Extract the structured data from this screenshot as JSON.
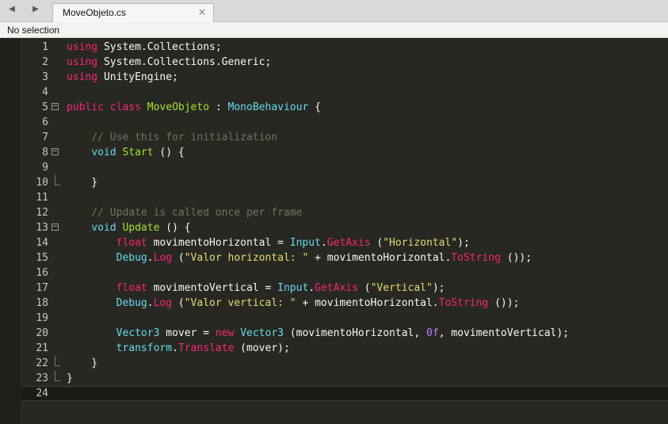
{
  "tab": {
    "title": "MoveObjeto.cs",
    "close": "×"
  },
  "nav": {
    "back": "◀",
    "forward": "▶"
  },
  "status": {
    "selection": "No selection"
  },
  "editor": {
    "current_line": 24,
    "lines": [
      {
        "n": "1",
        "fold": "",
        "tokens": [
          {
            "c": "k",
            "t": "using"
          },
          {
            "c": "p",
            "t": " System.Collections;"
          }
        ]
      },
      {
        "n": "2",
        "fold": "",
        "tokens": [
          {
            "c": "k",
            "t": "using"
          },
          {
            "c": "p",
            "t": " System.Collections.Generic;"
          }
        ]
      },
      {
        "n": "3",
        "fold": "",
        "tokens": [
          {
            "c": "k",
            "t": "using"
          },
          {
            "c": "p",
            "t": " UnityEngine;"
          }
        ]
      },
      {
        "n": "4",
        "fold": "",
        "tokens": []
      },
      {
        "n": "5",
        "fold": "open",
        "tokens": [
          {
            "c": "k",
            "t": "public"
          },
          {
            "c": "p",
            "t": " "
          },
          {
            "c": "k",
            "t": "class"
          },
          {
            "c": "p",
            "t": " "
          },
          {
            "c": "f",
            "t": "MoveObjeto"
          },
          {
            "c": "p",
            "t": " : "
          },
          {
            "c": "t",
            "t": "MonoBehaviour"
          },
          {
            "c": "p",
            "t": " {"
          }
        ]
      },
      {
        "n": "6",
        "fold": "",
        "tokens": []
      },
      {
        "n": "7",
        "fold": "",
        "tokens": [
          {
            "c": "p",
            "t": "    "
          },
          {
            "c": "c",
            "t": "// Use this for initialization"
          }
        ]
      },
      {
        "n": "8",
        "fold": "open",
        "tokens": [
          {
            "c": "p",
            "t": "    "
          },
          {
            "c": "t",
            "t": "void"
          },
          {
            "c": "p",
            "t": " "
          },
          {
            "c": "f",
            "t": "Start"
          },
          {
            "c": "p",
            "t": " () {"
          }
        ]
      },
      {
        "n": "9",
        "fold": "",
        "tokens": []
      },
      {
        "n": "10",
        "fold": "end",
        "tokens": [
          {
            "c": "p",
            "t": "    }"
          }
        ]
      },
      {
        "n": "11",
        "fold": "",
        "tokens": []
      },
      {
        "n": "12",
        "fold": "",
        "tokens": [
          {
            "c": "p",
            "t": "    "
          },
          {
            "c": "c",
            "t": "// Update is called once per frame"
          }
        ]
      },
      {
        "n": "13",
        "fold": "open",
        "tokens": [
          {
            "c": "p",
            "t": "    "
          },
          {
            "c": "t",
            "t": "void"
          },
          {
            "c": "p",
            "t": " "
          },
          {
            "c": "f",
            "t": "Update"
          },
          {
            "c": "p",
            "t": " () {"
          }
        ]
      },
      {
        "n": "14",
        "fold": "",
        "tokens": [
          {
            "c": "p",
            "t": "        "
          },
          {
            "c": "k",
            "t": "float"
          },
          {
            "c": "p",
            "t": " movimentoHorizontal = "
          },
          {
            "c": "t",
            "t": "Input"
          },
          {
            "c": "p",
            "t": "."
          },
          {
            "c": "k",
            "t": "GetAxis"
          },
          {
            "c": "p",
            "t": " ("
          },
          {
            "c": "s",
            "t": "\"Horizontal\""
          },
          {
            "c": "p",
            "t": ");"
          }
        ]
      },
      {
        "n": "15",
        "fold": "",
        "tokens": [
          {
            "c": "p",
            "t": "        "
          },
          {
            "c": "t",
            "t": "Debug"
          },
          {
            "c": "p",
            "t": "."
          },
          {
            "c": "k",
            "t": "Log"
          },
          {
            "c": "p",
            "t": " ("
          },
          {
            "c": "s",
            "t": "\"Valor horizontal: \""
          },
          {
            "c": "p",
            "t": " + movimentoHorizontal."
          },
          {
            "c": "k",
            "t": "ToString"
          },
          {
            "c": "p",
            "t": " ());"
          }
        ]
      },
      {
        "n": "16",
        "fold": "",
        "tokens": []
      },
      {
        "n": "17",
        "fold": "",
        "tokens": [
          {
            "c": "p",
            "t": "        "
          },
          {
            "c": "k",
            "t": "float"
          },
          {
            "c": "p",
            "t": " movimentoVertical = "
          },
          {
            "c": "t",
            "t": "Input"
          },
          {
            "c": "p",
            "t": "."
          },
          {
            "c": "k",
            "t": "GetAxis"
          },
          {
            "c": "p",
            "t": " ("
          },
          {
            "c": "s",
            "t": "\"Vertical\""
          },
          {
            "c": "p",
            "t": ");"
          }
        ]
      },
      {
        "n": "18",
        "fold": "",
        "tokens": [
          {
            "c": "p",
            "t": "        "
          },
          {
            "c": "t",
            "t": "Debug"
          },
          {
            "c": "p",
            "t": "."
          },
          {
            "c": "k",
            "t": "Log"
          },
          {
            "c": "p",
            "t": " ("
          },
          {
            "c": "s",
            "t": "\"Valor vertical: \""
          },
          {
            "c": "p",
            "t": " + movimentoHorizontal."
          },
          {
            "c": "k",
            "t": "ToString"
          },
          {
            "c": "p",
            "t": " ());"
          }
        ]
      },
      {
        "n": "19",
        "fold": "",
        "tokens": []
      },
      {
        "n": "20",
        "fold": "",
        "tokens": [
          {
            "c": "p",
            "t": "        "
          },
          {
            "c": "t",
            "t": "Vector3"
          },
          {
            "c": "p",
            "t": " mover = "
          },
          {
            "c": "k",
            "t": "new"
          },
          {
            "c": "p",
            "t": " "
          },
          {
            "c": "t",
            "t": "Vector3"
          },
          {
            "c": "p",
            "t": " (movimentoHorizontal, "
          },
          {
            "c": "n",
            "t": "0f"
          },
          {
            "c": "p",
            "t": ", movimentoVertical);"
          }
        ]
      },
      {
        "n": "21",
        "fold": "",
        "tokens": [
          {
            "c": "p",
            "t": "        "
          },
          {
            "c": "t",
            "t": "transform"
          },
          {
            "c": "p",
            "t": "."
          },
          {
            "c": "k",
            "t": "Translate"
          },
          {
            "c": "p",
            "t": " (mover);"
          }
        ]
      },
      {
        "n": "22",
        "fold": "end",
        "tokens": [
          {
            "c": "p",
            "t": "    }"
          }
        ]
      },
      {
        "n": "23",
        "fold": "end",
        "tokens": [
          {
            "c": "p",
            "t": "}"
          }
        ]
      },
      {
        "n": "24",
        "fold": "",
        "tokens": []
      }
    ]
  }
}
